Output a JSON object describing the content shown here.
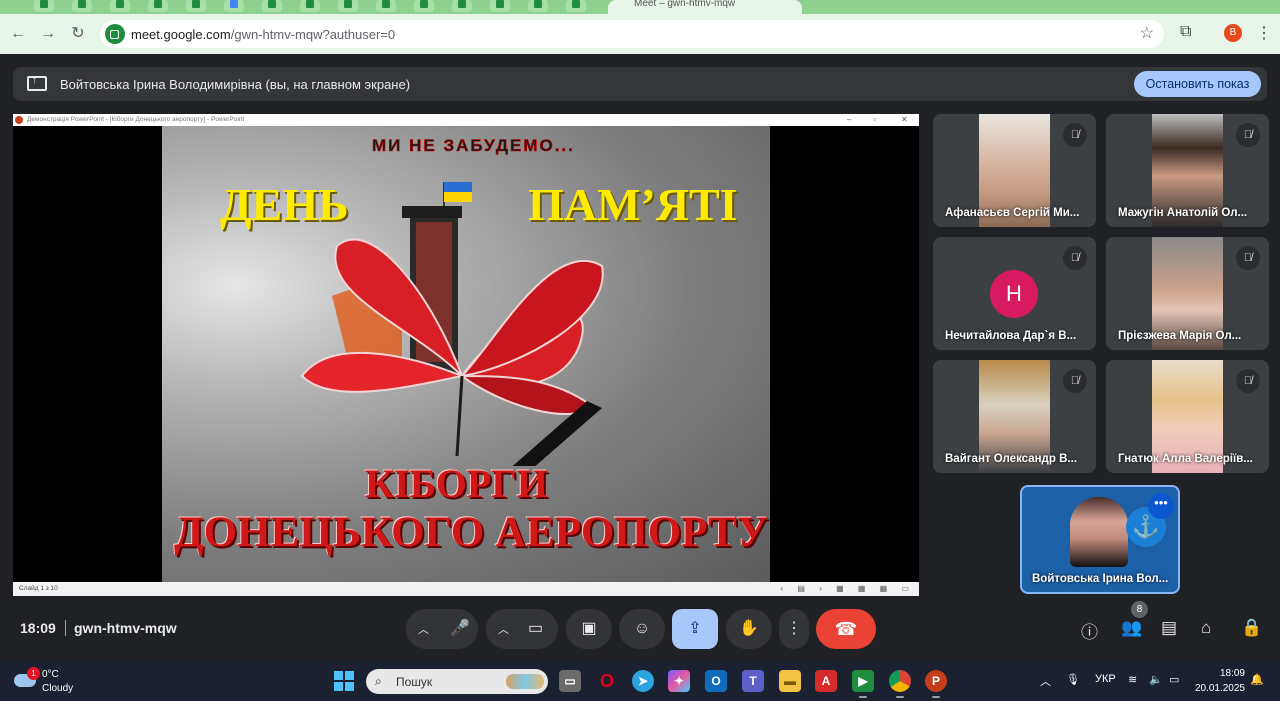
{
  "browser": {
    "tab_title": "Meet – gwn-htmv-mqw",
    "url_host": "meet.google.com",
    "url_path": "/gwn-htmv-mqw?authuser=0",
    "profile_initial": "B"
  },
  "banner": {
    "text": "Войтовська Ірина Володимирівна (вы, на главном экране)",
    "stop_label": "Остановить показ"
  },
  "presentation": {
    "window_title": "Демонстрація PowerPoint - [Кіборги Донецького аеропорту] - PowerPoint",
    "slide_counter": "Слайд 1 з 10",
    "slide": {
      "motto": "МИ НЕ ЗАБУДЕМО...",
      "word_left": "ДЕНЬ",
      "word_right": "ПАМ’ЯТІ",
      "line1": "КІБОРГИ",
      "line2": "ДОНЕЦЬКОГО АЕРОПОРТУ"
    }
  },
  "participants": [
    {
      "name": "Афанасьєв Сергій Ми...",
      "muted": true
    },
    {
      "name": "Мажугін Анатолій Ол...",
      "muted": true
    },
    {
      "name": "Нечитайлова Дар`я В...",
      "avatar": "Н",
      "muted": true
    },
    {
      "name": "Прієзжева Марія Ол...",
      "muted": true
    },
    {
      "name": "Вайгант Олександр В...",
      "muted": true
    },
    {
      "name": "Гнатюк Алла Валеріїв...",
      "muted": true
    }
  ],
  "self": {
    "name": "Войтовська Ірина Вол..."
  },
  "meetbar": {
    "time": "18:09",
    "meeting_code": "gwn-htmv-mqw",
    "participant_count": "8"
  },
  "taskbar": {
    "weather_badge": "1",
    "temperature": "0°C",
    "condition": "Cloudy",
    "search_placeholder": "Пошук",
    "language": "УКР",
    "clock": "18:09",
    "date": "20.01.2025"
  },
  "colors": {
    "meet_bg": "#202124",
    "accent": "#a8c7fa",
    "end_call": "#ea4335",
    "chrome_green": "#8fd18e"
  }
}
